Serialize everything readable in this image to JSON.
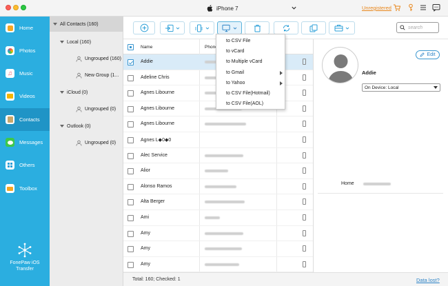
{
  "window": {
    "device_name": "iPhone 7",
    "unregistered_label": "Unregistered"
  },
  "sidebar": {
    "items": [
      {
        "label": "Home",
        "icon": "home-icon",
        "color": "#f5a623"
      },
      {
        "label": "Photos",
        "icon": "photos-icon",
        "color": "#e94e6a"
      },
      {
        "label": "Music",
        "icon": "music-icon",
        "color": "#f14b5d"
      },
      {
        "label": "Videos",
        "icon": "videos-icon",
        "color": "#f7b500"
      },
      {
        "label": "Contacts",
        "icon": "contacts-icon",
        "color": "#c8a76b"
      },
      {
        "label": "Messages",
        "icon": "messages-icon",
        "color": "#3ec74b"
      },
      {
        "label": "Others",
        "icon": "others-icon",
        "color": "#2a9fd8"
      },
      {
        "label": "Toolbox",
        "icon": "toolbox-icon",
        "color": "#f5a623"
      }
    ],
    "active": "Contacts",
    "brand": [
      "FonePaw iOS",
      "Transfer"
    ]
  },
  "tree": {
    "all_contacts": "All Contacts  (160)",
    "groups": [
      {
        "label": "Local  (160)",
        "children": [
          "Ungrouped  (160)",
          "New Group (1..."
        ]
      },
      {
        "label": "iCloud  (0)",
        "children": [
          "Ungrouped  (0)"
        ]
      },
      {
        "label": "Outlook  (0)",
        "children": [
          "Ungrouped  (0)"
        ]
      }
    ]
  },
  "toolbar": {
    "search_placeholder": "search"
  },
  "table": {
    "headers": {
      "name": "Name",
      "phone": "Phone"
    },
    "rows": [
      {
        "name": "Addie",
        "selected": true
      },
      {
        "name": "Adeline Chris",
        "selected": false
      },
      {
        "name": "Agnes Libourne",
        "selected": false
      },
      {
        "name": "Agnes Libourne",
        "selected": false
      },
      {
        "name": "Agnes Libourne",
        "selected": false
      },
      {
        "name": "Agnes L◆0◆0",
        "selected": false
      },
      {
        "name": "Alec Service",
        "selected": false
      },
      {
        "name": "Alior",
        "selected": false
      },
      {
        "name": "Alonso Ramos",
        "selected": false
      },
      {
        "name": "Alta Berger",
        "selected": false
      },
      {
        "name": "Ami",
        "selected": false
      },
      {
        "name": "Amy",
        "selected": false
      },
      {
        "name": "Amy",
        "selected": false
      },
      {
        "name": "Amy",
        "selected": false
      }
    ]
  },
  "export_menu": {
    "items": [
      {
        "label": "to CSV File",
        "submenu": false
      },
      {
        "label": "to vCard",
        "submenu": false
      },
      {
        "label": "to Multiple vCard",
        "submenu": false
      },
      {
        "label": "to Gmail",
        "submenu": true
      },
      {
        "label": "to Yahoo",
        "submenu": true
      },
      {
        "label": "to CSV File(Hotmail)",
        "submenu": false
      },
      {
        "label": "to CSV File(AOL)",
        "submenu": false
      }
    ]
  },
  "detail": {
    "edit_label": "Edit",
    "contact_name": "Addie",
    "location_select": "On Device: Local",
    "home_label": "Home"
  },
  "footer": {
    "status": "Total: 160; Checked: 1",
    "data_lost_link": "Data lost?"
  },
  "colors": {
    "sidebar": "#2baee0",
    "sidebar_active": "#1f94c6",
    "accent": "#3a96d0",
    "unregistered": "#e8861a"
  }
}
